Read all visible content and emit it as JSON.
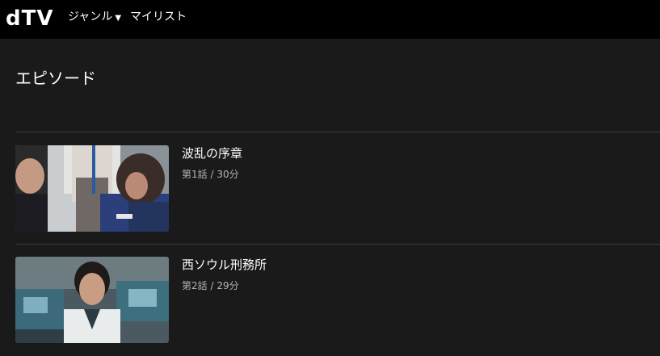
{
  "header": {
    "logo": "dTV",
    "nav": {
      "genre": "ジャンル",
      "genre_caret": "▼",
      "mylist": "マイリスト"
    }
  },
  "section": {
    "title": "エピソード"
  },
  "episodes": [
    {
      "title": "波乱の序章",
      "number": "第1話",
      "separator": "/",
      "duration": "30分"
    },
    {
      "title": "西ソウル刑務所",
      "number": "第2話",
      "separator": "/",
      "duration": "29分"
    }
  ]
}
